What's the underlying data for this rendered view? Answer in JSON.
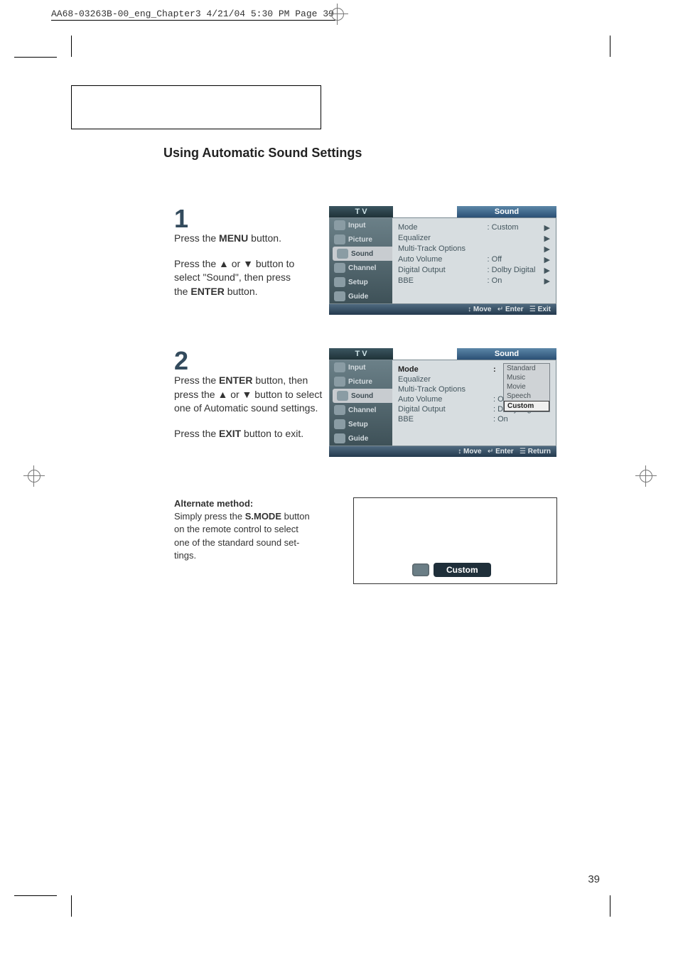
{
  "header_line": "AA68-03263B-00_eng_Chapter3  4/21/04  5:30 PM  Page 39",
  "section_title": "Using Automatic Sound Settings",
  "step1": {
    "num": "1",
    "line1_a": "Press the ",
    "line1_b": "MENU",
    "line1_c": " button.",
    "line2_a": "Press the ▲ or ▼ button to select \"Sound\", then press the ",
    "line2_b": "ENTER",
    "line2_c": " button."
  },
  "step2": {
    "num": "2",
    "line1_a": "Press the ",
    "line1_b": "ENTER",
    "line1_c": " button, then press the ▲ or ▼ button to select one of Automatic sound settings.",
    "line2_a": "Press the ",
    "line2_b": "EXIT",
    "line2_c": " button to exit."
  },
  "alt": {
    "title": "Alternate method:",
    "body_a": "Simply press the ",
    "body_b": "S.MODE",
    "body_c": " button on the remote control to select one of the standard sound       set-tings."
  },
  "osd_common": {
    "tv": "T V",
    "title": "Sound",
    "left": [
      "Input",
      "Picture",
      "Sound",
      "Channel",
      "Setup",
      "Guide"
    ],
    "menu_items": [
      {
        "label": "Mode",
        "value": ": Custom"
      },
      {
        "label": "Equalizer",
        "value": ""
      },
      {
        "label": "Multi-Track Options",
        "value": ""
      },
      {
        "label": "Auto Volume",
        "value": ": Off"
      },
      {
        "label": "Digital Output",
        "value": ": Dolby Digital"
      },
      {
        "label": "BBE",
        "value": ": On"
      }
    ],
    "foot_move": "Move",
    "foot_enter": "Enter"
  },
  "osd1_foot_last": "Exit",
  "osd2": {
    "sel_label": "Mode",
    "options": [
      "Standard",
      "Music",
      "Movie",
      "Speech",
      "Custom"
    ],
    "foot_last": "Return",
    "values": {
      "auto_volume": ": Off",
      "digital_out": ": Dolby Digital",
      "bbe": ": On"
    }
  },
  "custom_bubble": "Custom",
  "page_number": "39",
  "icons": {
    "move": "↕",
    "enter": "↵",
    "menu": "☰",
    "play": "▶"
  }
}
